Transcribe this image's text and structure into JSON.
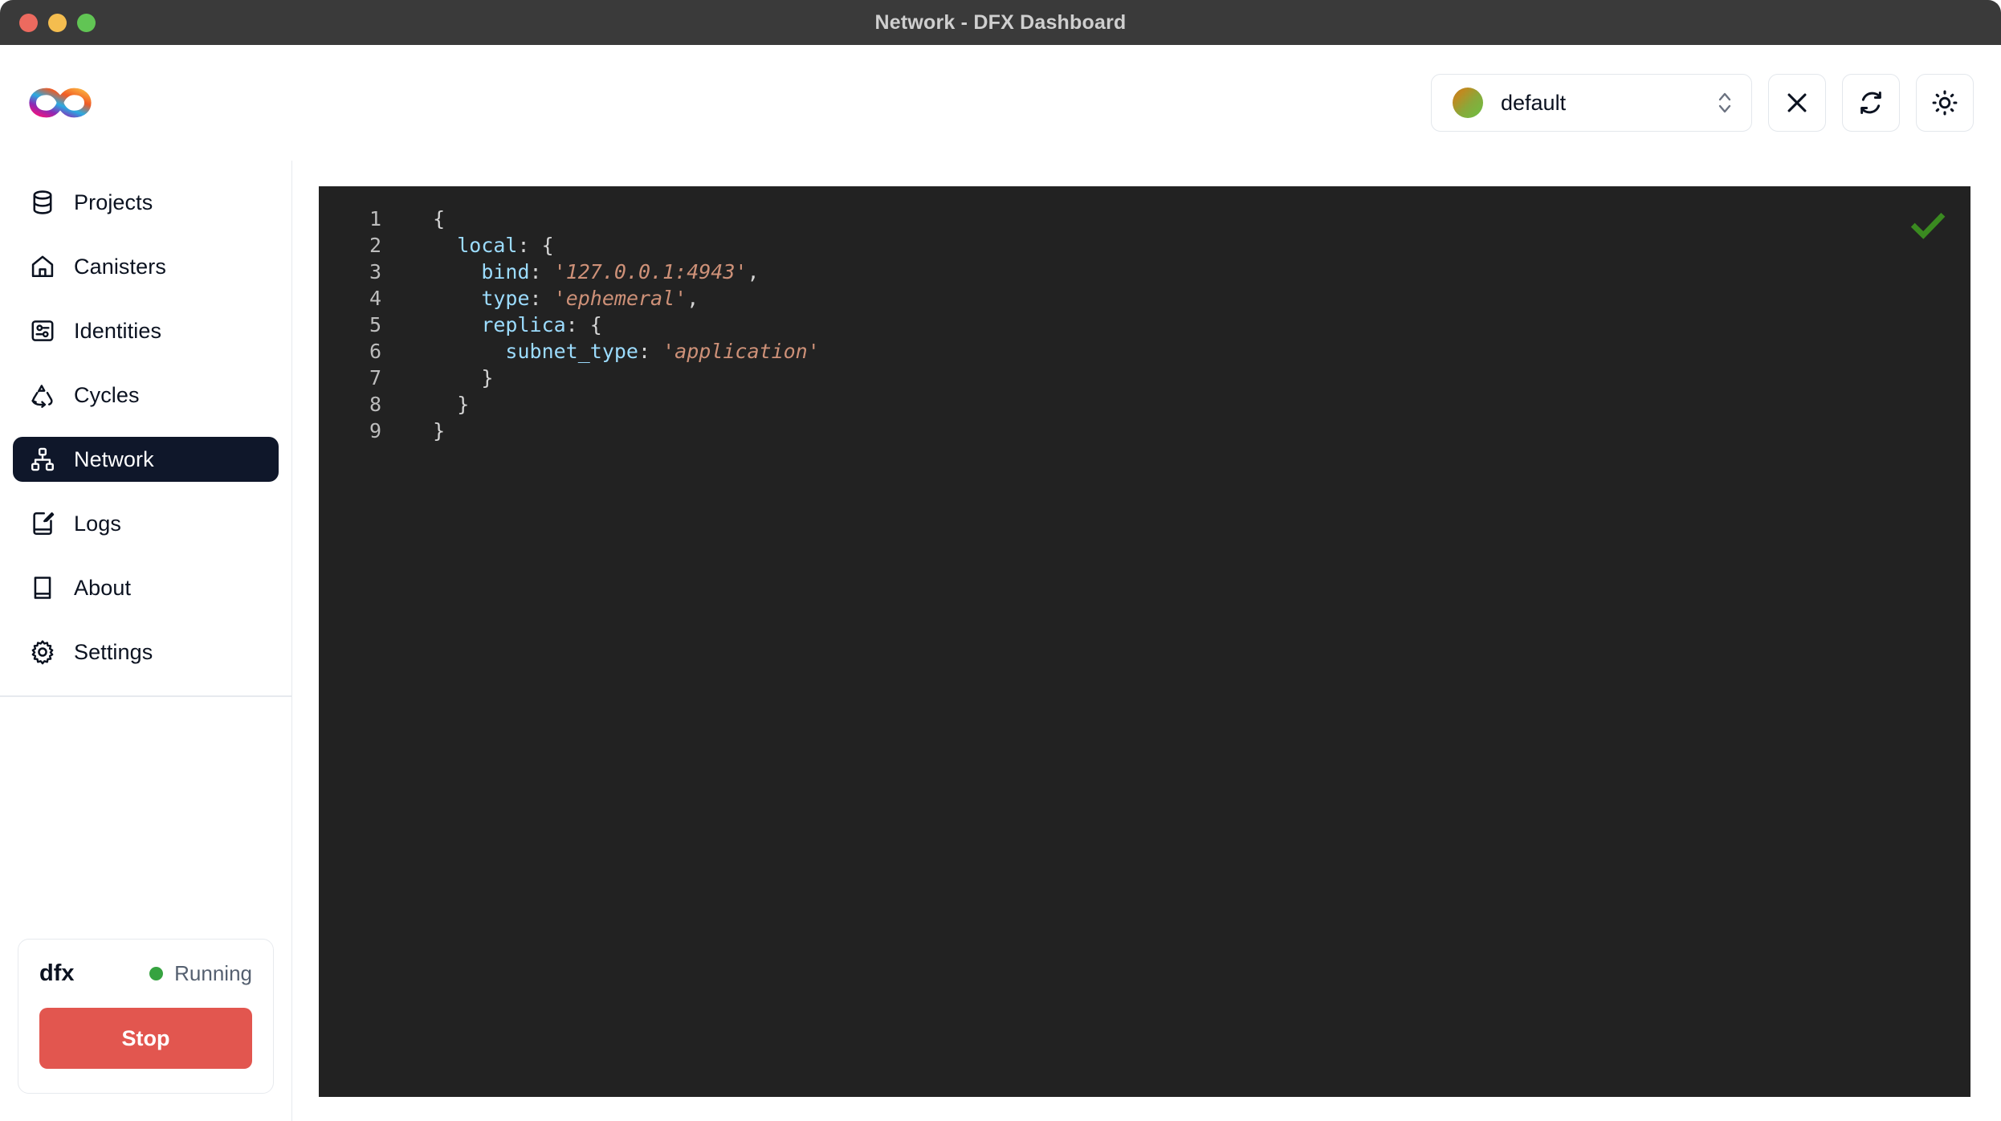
{
  "window": {
    "title": "Network - DFX Dashboard",
    "traffic_lights": [
      "close",
      "minimize",
      "maximize"
    ]
  },
  "toolbar": {
    "logo_icon": "internet-computer-infinity-logo",
    "identity": {
      "selected": "default",
      "avatar_icon": "identity-avatar-gradient",
      "chevron_icon": "chevron-up-down-icon"
    },
    "buttons": [
      {
        "name": "close-button",
        "icon": "close-x-icon"
      },
      {
        "name": "refresh-button",
        "icon": "refresh-icon"
      },
      {
        "name": "theme-toggle-button",
        "icon": "sun-icon"
      }
    ]
  },
  "sidebar": {
    "items": [
      {
        "label": "Projects",
        "icon": "database-icon",
        "active": false
      },
      {
        "label": "Canisters",
        "icon": "home-icon",
        "active": false
      },
      {
        "label": "Identities",
        "icon": "contact-card-icon",
        "active": false
      },
      {
        "label": "Cycles",
        "icon": "recycle-icon",
        "active": false
      },
      {
        "label": "Network",
        "icon": "network-nodes-icon",
        "active": true
      },
      {
        "label": "Logs",
        "icon": "notebook-pen-icon",
        "active": false
      },
      {
        "label": "About",
        "icon": "book-icon",
        "active": false
      },
      {
        "label": "Settings",
        "icon": "gear-icon",
        "active": false
      }
    ],
    "dfx_card": {
      "title": "dfx",
      "status_label": "Running",
      "status_color": "#36a340",
      "action_label": "Stop",
      "action_color": "#e2564f"
    }
  },
  "editor": {
    "background": "#222222",
    "valid_icon": "green-checkmark-icon",
    "valid_icon_color": "#3a8a20",
    "line_numbers": [
      1,
      2,
      3,
      4,
      5,
      6,
      7,
      8,
      9
    ],
    "lines": [
      {
        "indent": "  ",
        "tokens": [
          {
            "t": "punct",
            "v": "{"
          }
        ]
      },
      {
        "indent": "    ",
        "tokens": [
          {
            "t": "key",
            "v": "local"
          },
          {
            "t": "punct",
            "v": ": {"
          }
        ]
      },
      {
        "indent": "      ",
        "tokens": [
          {
            "t": "key",
            "v": "bind"
          },
          {
            "t": "punct",
            "v": ": "
          },
          {
            "t": "str",
            "v": "'127.0.0.1:4943'"
          },
          {
            "t": "punct",
            "v": ","
          }
        ]
      },
      {
        "indent": "      ",
        "tokens": [
          {
            "t": "key",
            "v": "type"
          },
          {
            "t": "punct",
            "v": ": "
          },
          {
            "t": "str",
            "v": "'ephemeral'"
          },
          {
            "t": "punct",
            "v": ","
          }
        ]
      },
      {
        "indent": "      ",
        "tokens": [
          {
            "t": "key",
            "v": "replica"
          },
          {
            "t": "punct",
            "v": ": {"
          }
        ]
      },
      {
        "indent": "        ",
        "tokens": [
          {
            "t": "key",
            "v": "subnet_type"
          },
          {
            "t": "punct",
            "v": ": "
          },
          {
            "t": "str",
            "v": "'application'"
          }
        ]
      },
      {
        "indent": "      ",
        "tokens": [
          {
            "t": "punct",
            "v": "}"
          }
        ]
      },
      {
        "indent": "    ",
        "tokens": [
          {
            "t": "punct",
            "v": "}"
          }
        ]
      },
      {
        "indent": "  ",
        "tokens": [
          {
            "t": "punct",
            "v": "}"
          }
        ]
      }
    ]
  }
}
